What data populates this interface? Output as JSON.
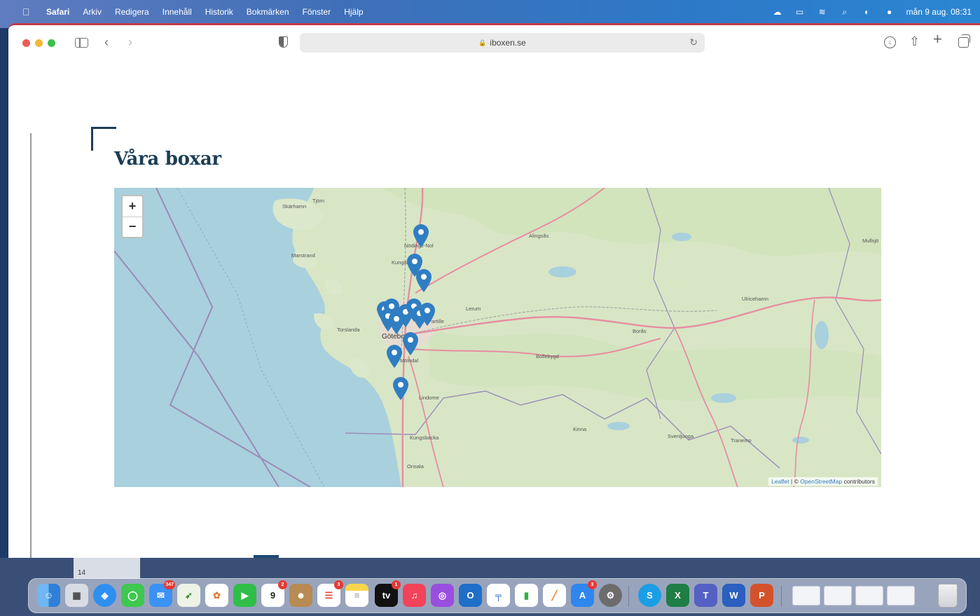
{
  "menubar": {
    "app_name": "Safari",
    "items": [
      "Arkiv",
      "Redigera",
      "Innehåll",
      "Historik",
      "Bokmärken",
      "Fönster",
      "Hjälp"
    ],
    "clock": "mån 9 aug. 08:31"
  },
  "browser": {
    "url": "iboxen.se"
  },
  "page": {
    "title": "Våra boxar"
  },
  "map": {
    "zoom_in": "+",
    "zoom_out": "−",
    "attribution_leaflet": "Leaflet",
    "attribution_separator": " | © ",
    "attribution_osm": "OpenStreetMap",
    "attribution_contributors": " contributors",
    "labels": {
      "tjorn": "Tjörn",
      "skarhamn": "Skärhamn",
      "marstrand": "Marstrand",
      "nodinge_nol": "Nödinge-Nol",
      "kungalv": "Kungälv",
      "alingsas": "Alingsås",
      "lerum": "Lerum",
      "torslanda": "Torslanda",
      "goteborg": "Göteborg",
      "partille": "Partille",
      "molndal": "Mölndal",
      "bollebygd": "Bollebygd",
      "boras": "Borås",
      "ulricehamn": "Ulricehamn",
      "lindome": "Lindome",
      "kungsbacka": "Kungsbacka",
      "kinna": "Kinna",
      "svenljunga": "Svenljunga",
      "tranemo": "Tranemo",
      "onsala": "Onsala",
      "mullsjo": "Mullsjö"
    },
    "marker_color": "#2f7ec2"
  },
  "dock": {
    "finder_column_number": "14",
    "calendar_day": "9",
    "badges": {
      "mail": "347",
      "calendar": "2",
      "reminders": "3",
      "appletv": "1",
      "appstore": "3"
    }
  }
}
